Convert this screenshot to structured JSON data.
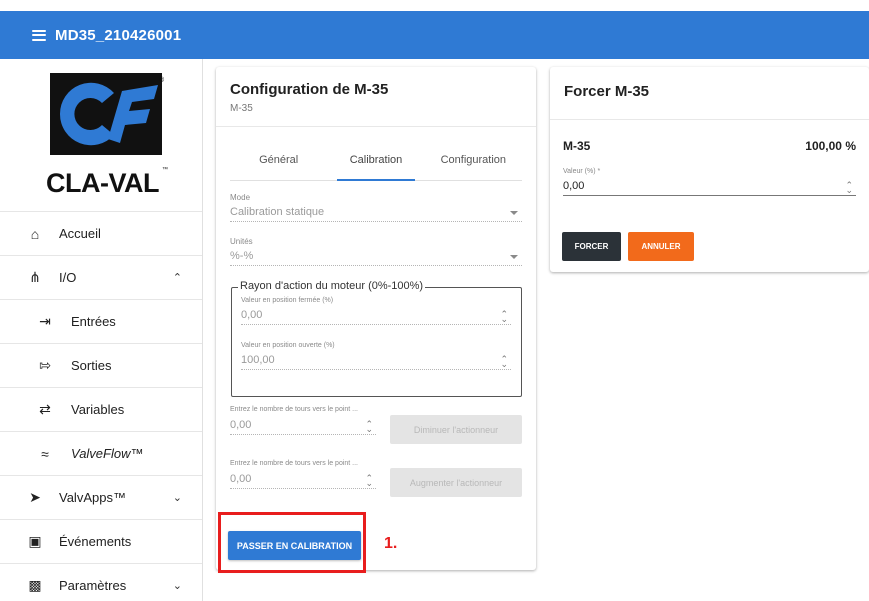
{
  "header": {
    "title": "MD35_210426001"
  },
  "logo": {
    "text": "CLA-VAL",
    "tm": "™",
    "reg": "®"
  },
  "sidebar": {
    "items": [
      {
        "label": "Accueil",
        "icon": "home-icon"
      },
      {
        "label": "I/O",
        "icon": "io-icon"
      },
      {
        "label": "Entrées",
        "icon": "login-icon"
      },
      {
        "label": "Sorties",
        "icon": "logout-icon"
      },
      {
        "label": "Variables",
        "icon": "swap-icon"
      },
      {
        "label": "ValveFlow™",
        "icon": "waves-icon"
      },
      {
        "label": "ValvApps™",
        "icon": "apps-icon"
      },
      {
        "label": "Événements",
        "icon": "calendar-icon"
      },
      {
        "label": "Paramètres",
        "icon": "settings-icon"
      }
    ]
  },
  "config": {
    "title": "Configuration de M-35",
    "subtitle": "M-35",
    "tabs": [
      "Général",
      "Calibration",
      "Configuration"
    ],
    "active_tab": "Calibration",
    "mode_label": "Mode",
    "mode_value": "Calibration statique",
    "units_label": "Unités",
    "units_value": "%-%",
    "range_legend": "Rayon d'action du moteur (0%-100%)",
    "closed_label": "Valeur en position fermée (%)",
    "closed_value": "0,00",
    "open_label": "Valeur en position ouverte (%)",
    "open_value": "100,00",
    "turns_label_1": "Entrez le nombre de tours vers le point ...",
    "turns_value_1": "0,00",
    "decrease_button": "Diminuer l'actionneur",
    "turns_label_2": "Entrez le nombre de tours vers le point ...",
    "turns_value_2": "0,00",
    "increase_button": "Augmenter l'actionneur",
    "calibrate_button": "PASSER EN CALIBRATION",
    "step_marker": "1."
  },
  "force": {
    "title": "Forcer M-35",
    "device": "M-35",
    "percent": "100,00 %",
    "value_label": "Valeur (%) *",
    "value": "0,00",
    "force_button": "FORCER",
    "cancel_button": "ANNULER"
  },
  "colors": {
    "primary": "#2f7ad4",
    "accent": "#f26a1b",
    "dark": "#2b3238",
    "highlight": "#e81d1d"
  }
}
